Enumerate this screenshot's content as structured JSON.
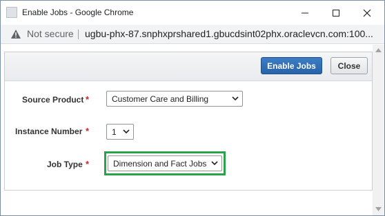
{
  "window": {
    "title": "Enable Jobs - Google Chrome"
  },
  "addressbar": {
    "security_label": "Not secure",
    "url": "ugbu-phx-87.snphxprshared1.gbucdsint02phx.oraclevcn.com:100..."
  },
  "toolbar": {
    "enable_jobs_label": "Enable Jobs",
    "close_label": "Close"
  },
  "form": {
    "source_product": {
      "label": "Source Product",
      "required_marker": "*",
      "value": "Customer Care and Billing"
    },
    "instance_number": {
      "label": "Instance Number",
      "required_marker": "*",
      "value": "1"
    },
    "job_type": {
      "label": "Job Type",
      "required_marker": "*",
      "value": "Dimension and Fact Jobs"
    }
  },
  "colors": {
    "primary_button": "#2863a8",
    "required": "#c8252c",
    "highlight": "#2aa24a"
  }
}
